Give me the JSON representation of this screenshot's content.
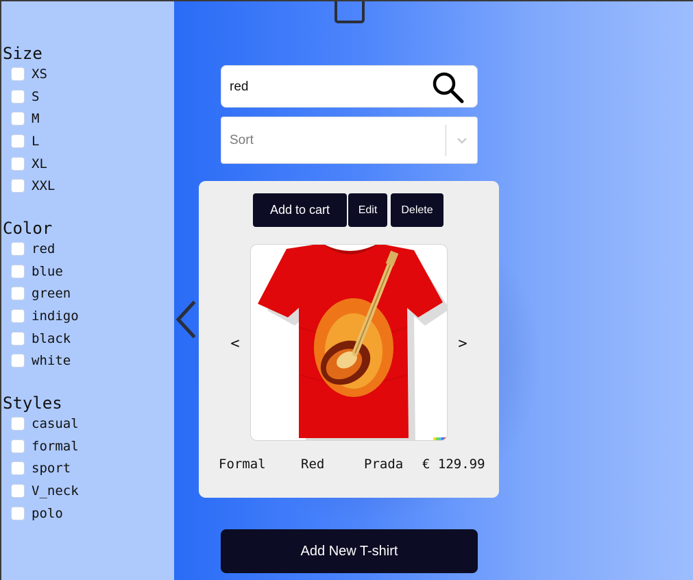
{
  "filters": {
    "size": {
      "title": "Size",
      "options": [
        "XS",
        "S",
        "M",
        "L",
        "XL",
        "XXL"
      ]
    },
    "color": {
      "title": "Color",
      "options": [
        "red",
        "blue",
        "green",
        "indigo",
        "black",
        "white"
      ]
    },
    "styles": {
      "title": "Styles",
      "options": [
        "casual",
        "formal",
        "sport",
        "V_neck",
        "polo"
      ]
    }
  },
  "search": {
    "value": "red"
  },
  "sort": {
    "placeholder": "Sort"
  },
  "product_card": {
    "add_to_cart_label": "Add to cart",
    "edit_label": "Edit",
    "delete_label": "Delete",
    "prev_label": "<",
    "next_label": ">",
    "style": "Formal",
    "color": "Red",
    "brand": "Prada",
    "price": "€ 129.99",
    "image_icon": "red-tshirt-guitar-image"
  },
  "add_new_label": "Add New T-shirt",
  "colors": {
    "sidebar_bg": "#aecafd",
    "button_bg": "#0c0d24",
    "card_bg": "#eeeeee",
    "gradient_start": "#2a6cf6",
    "gradient_end": "#9dbdfd"
  }
}
